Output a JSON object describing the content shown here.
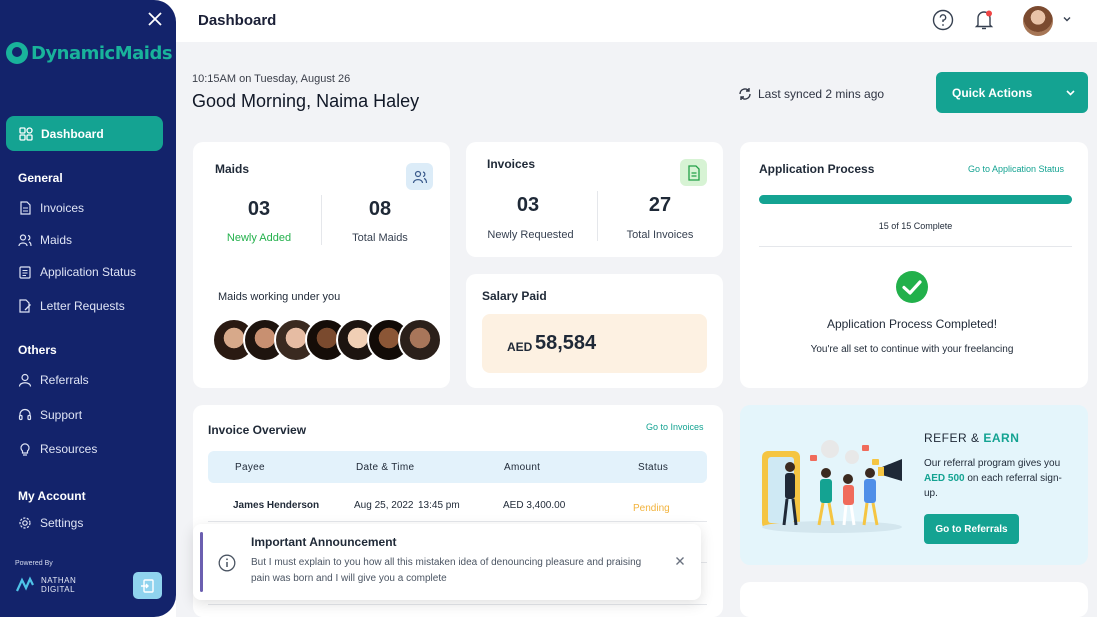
{
  "sidebar": {
    "logo": "DynamicMaids",
    "active_item": "Dashboard",
    "sections": {
      "general": "General",
      "others": "Others",
      "account": "My Account"
    },
    "general_items": [
      "Invoices",
      "Maids",
      "Application Status",
      "Letter Requests"
    ],
    "other_items": [
      "Referrals",
      "Support",
      "Resources"
    ],
    "account_items": [
      "Settings"
    ],
    "powered_by": "Powered By",
    "brand_line1": "NATHAN",
    "brand_line2": "DIGITAL"
  },
  "header": {
    "title": "Dashboard"
  },
  "greeting": {
    "time": "10:15AM on Tuesday, August 26",
    "text": "Good Morning, Naima Haley",
    "sync": "Last synced 2 mins ago",
    "quick_actions": "Quick Actions"
  },
  "maids_card": {
    "title": "Maids",
    "newly_added_value": "03",
    "newly_added_label": "Newly Added",
    "total_value": "08",
    "total_label": "Total Maids",
    "working_label": "Maids working under you"
  },
  "invoices_card": {
    "title": "Invoices",
    "requested_value": "03",
    "requested_label": "Newly Requested",
    "total_value": "27",
    "total_label": "Total Invoices"
  },
  "salary_card": {
    "title": "Salary Paid",
    "currency": "AED",
    "amount": "58,584"
  },
  "application_card": {
    "title": "Application Process",
    "link": "Go to Application Status",
    "progress_label": "15 of 15 Complete",
    "progress_fraction": 1.0,
    "complete_title": "Application Process Completed!",
    "complete_sub": "You're all set to continue with your freelancing"
  },
  "invoice_overview": {
    "title": "Invoice Overview",
    "link": "Go to Invoices",
    "columns": [
      "Payee",
      "Date & Time",
      "Amount",
      "Status"
    ],
    "rows": [
      {
        "payee": "James Henderson",
        "date": "Aug 25, 2022",
        "time": "13:45 pm",
        "amount": "AED 3,400.00",
        "status": "Pending"
      }
    ]
  },
  "refer": {
    "title_a": "REFER &",
    "title_b": "EARN",
    "desc_a": "Our referral program gives you",
    "desc_amount": "AED 500",
    "desc_b": "on each referral sign-up.",
    "button": "Go to Referrals"
  },
  "announcement": {
    "title": "Important Announcement",
    "message": "But I must explain to you how all this mistaken idea of denouncing pleasure and praising pain was born and I will give you a complete"
  },
  "colors": {
    "sidebar": "#13236b",
    "accent": "#14a392",
    "pending": "#f2b33d",
    "newly_added": "#22b04b"
  }
}
